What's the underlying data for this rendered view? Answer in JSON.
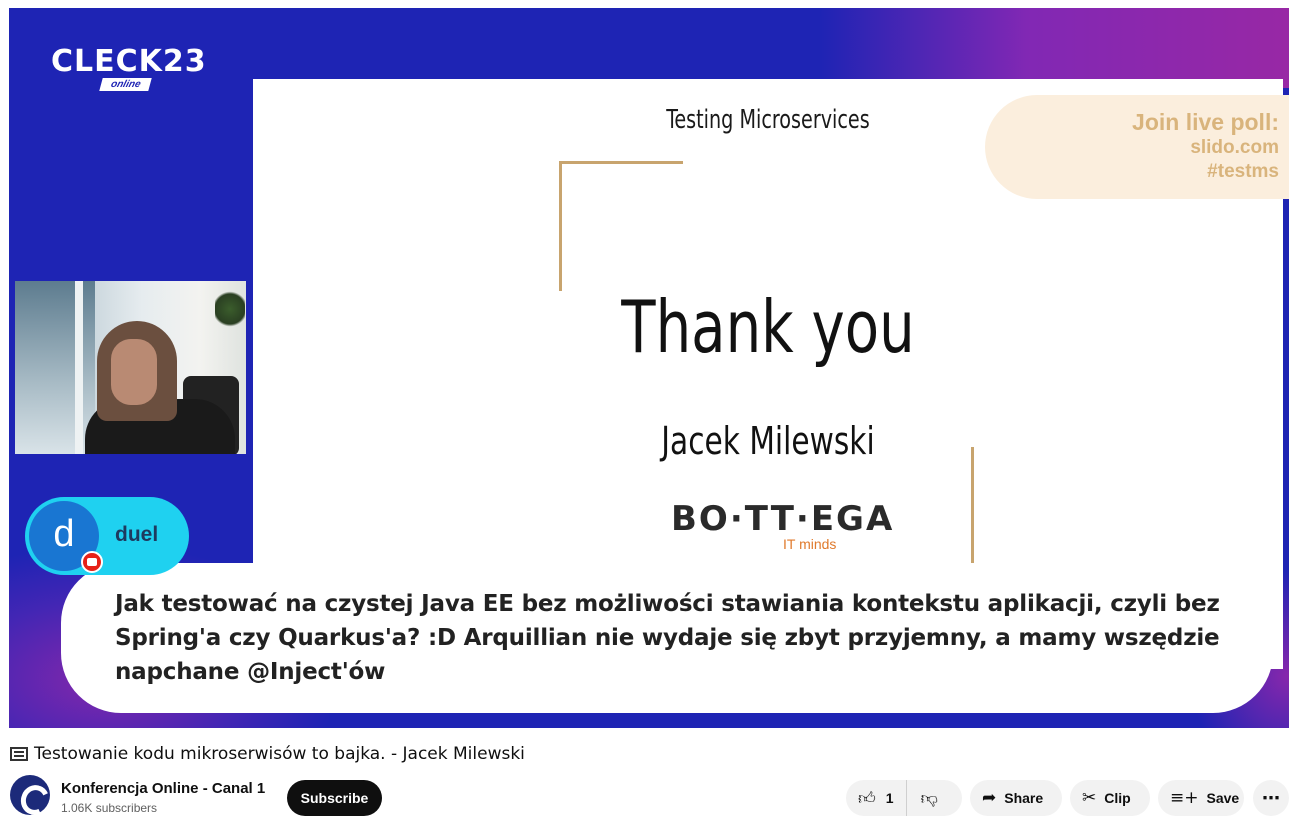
{
  "video": {
    "logo_text": "CLECK23",
    "logo_sub": "online",
    "slide": {
      "title": "Testing Microservices",
      "heading": "Thank you",
      "speaker": "Jacek Milewski",
      "brand": "BO·TT·EGA",
      "brand_sub": "IT minds",
      "poll": {
        "head": "Join live poll:",
        "line1": "slido.com",
        "line2": "#testms"
      }
    },
    "chat": {
      "avatar_letter": "d",
      "author": "duel",
      "message": "Jak testować na czystej Java EE bez możliwości stawiania kontekstu aplikacji, czyli bez Spring'a czy Quarkus'a? :D Arquillian nie wydaje się zbyt przyjemny, a mamy wszędzie napchane @Inject'ów"
    }
  },
  "title": "Testowanie kodu mikroserwisów to bajka. - Jacek Milewski",
  "channel": {
    "name": "Konferencja Online - Canal 1",
    "subscribers": "1.06K subscribers",
    "subscribe_label": "Subscribe"
  },
  "actions": {
    "like_count": "1",
    "share_label": "Share",
    "clip_label": "Clip",
    "save_label": "Save",
    "more_label": "⋯"
  },
  "icons": {
    "like": "thumbs-up-icon",
    "dislike": "thumbs-down-icon",
    "share": "share-arrow-icon",
    "clip": "scissors-icon",
    "save": "playlist-add-icon",
    "more": "more-horizontal-icon"
  },
  "colors": {
    "video_bg": "#1e24b4",
    "poll_text": "#d9b47c",
    "badge": "#1fd1f0",
    "subscribe_bg": "#0f0f0f"
  }
}
